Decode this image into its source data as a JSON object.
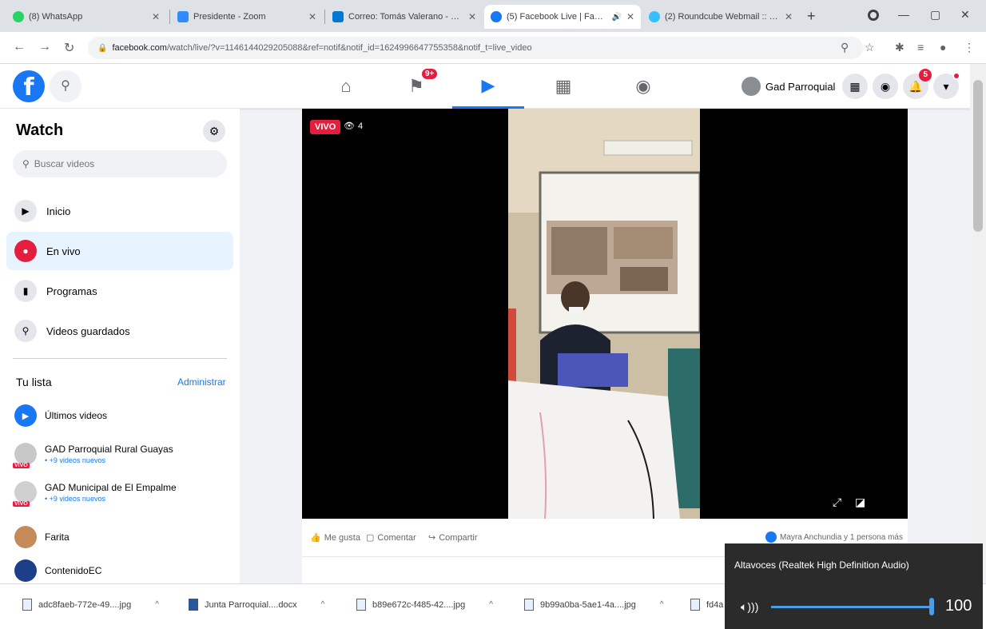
{
  "browser": {
    "tabs": [
      {
        "title": "(8) WhatsApp",
        "favicon_color": "#25d366"
      },
      {
        "title": "Presidente - Zoom",
        "favicon_color": "#2d8cff"
      },
      {
        "title": "Correo: Tomás Valerano - O...",
        "favicon_color": "#0078d4"
      },
      {
        "title": "(5) Facebook Live | Faceb...",
        "favicon_color": "#1877f2"
      },
      {
        "title": "(2) Roundcube Webmail :: E...",
        "favicon_color": "#37beff"
      }
    ],
    "active_tab": 3,
    "new_tab": "+",
    "address": {
      "host": "facebook.com",
      "path": "/watch/live/?v=1146144029205088&ref=notif&notif_id=1624996647755358&notif_t=live_video"
    }
  },
  "fb": {
    "logo": "f",
    "nav": [
      {
        "name": "home",
        "icon": "⌂"
      },
      {
        "name": "pages",
        "icon": "⚑",
        "badge": "9+"
      },
      {
        "name": "watch",
        "icon": "▶"
      },
      {
        "name": "marketplace",
        "icon": "▦"
      },
      {
        "name": "groups",
        "icon": "◉"
      }
    ],
    "active_nav": 2,
    "profile_name": "Gad Parroquial",
    "notifications_badge": "5"
  },
  "sidebar": {
    "title": "Watch",
    "search_placeholder": "Buscar videos",
    "items": [
      {
        "label": "Inicio",
        "icon": "▶"
      },
      {
        "label": "En vivo",
        "icon": "●"
      },
      {
        "label": "Programas",
        "icon": "▮"
      },
      {
        "label": "Videos guardados",
        "icon": "⚲"
      }
    ],
    "active_item": 1,
    "list_title": "Tu lista",
    "manage_label": "Administrar",
    "subscriptions": [
      {
        "name": "Últimos videos",
        "meta": "",
        "color": "#1877f2",
        "live": false
      },
      {
        "name": "GAD Parroquial Rural Guayas",
        "meta": "• +9 videos nuevos",
        "color": "#c8c8c8",
        "live": true
      },
      {
        "name": "GAD Municipal de El Empalme",
        "meta": "• +9 videos nuevos",
        "color": "#d0d0d0",
        "live": true
      },
      {
        "name": "Farita",
        "meta": "",
        "color": "#c48a5a",
        "live": false
      },
      {
        "name": "ContenidoEC",
        "meta": "",
        "color": "#1d3f8a",
        "live": false
      }
    ]
  },
  "video": {
    "live_label": "VIVO",
    "viewer_count": "4"
  },
  "actions": {
    "like": "Me gusta",
    "comment": "Comentar",
    "share": "Compartir",
    "reactions_text": "Mayra Anchundia y 1 persona más"
  },
  "downloads": [
    {
      "name": "adc8faeb-772e-49....jpg"
    },
    {
      "name": "Junta Parroquial....docx"
    },
    {
      "name": "b89e672c-f485-42....jpg"
    },
    {
      "name": "9b99a0ba-5ae1-4a....jpg"
    },
    {
      "name": "fd4a"
    }
  ],
  "volume": {
    "device": "Altavoces (Realtek High Definition Audio)",
    "level": 100
  },
  "colors": {
    "fb_blue": "#1877f2",
    "live_red": "#e41e3f",
    "flyout_bg": "#2b2b2b",
    "slider_accent": "#4a9ee8"
  }
}
